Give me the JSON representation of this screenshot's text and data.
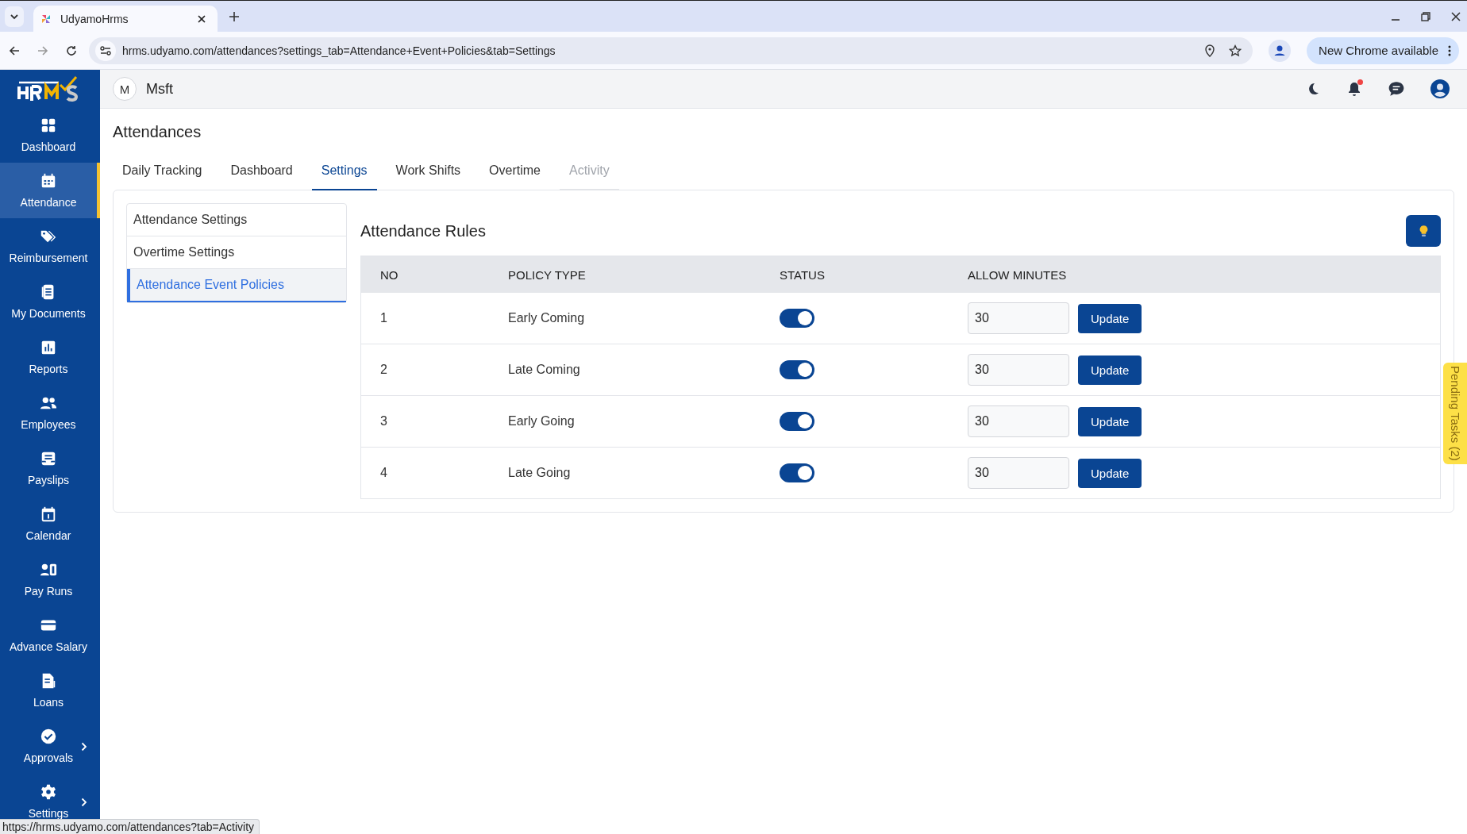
{
  "browser": {
    "tab_title": "UdyamoHrms",
    "url": "hrms.udyamo.com/attendances?settings_tab=Attendance+Event+Policies&tab=Settings",
    "update_button": "New Chrome available"
  },
  "sidebar": {
    "items": [
      {
        "label": "Dashboard",
        "selected": false,
        "expandable": false
      },
      {
        "label": "Attendance",
        "selected": true,
        "expandable": false
      },
      {
        "label": "Reimbursement",
        "selected": false,
        "expandable": false
      },
      {
        "label": "My Documents",
        "selected": false,
        "expandable": false
      },
      {
        "label": "Reports",
        "selected": false,
        "expandable": false
      },
      {
        "label": "Employees",
        "selected": false,
        "expandable": false
      },
      {
        "label": "Payslips",
        "selected": false,
        "expandable": false
      },
      {
        "label": "Calendar",
        "selected": false,
        "expandable": false
      },
      {
        "label": "Pay Runs",
        "selected": false,
        "expandable": false
      },
      {
        "label": "Advance Salary",
        "selected": false,
        "expandable": false
      },
      {
        "label": "Loans",
        "selected": false,
        "expandable": false
      },
      {
        "label": "Approvals",
        "selected": false,
        "expandable": true
      },
      {
        "label": "Settings",
        "selected": false,
        "expandable": true
      }
    ]
  },
  "header": {
    "avatar_letter": "M",
    "company": "Msft",
    "notification_dot": true
  },
  "page": {
    "title": "Attendances",
    "tabs": [
      {
        "label": "Daily Tracking",
        "selected": false,
        "hovered": false
      },
      {
        "label": "Dashboard",
        "selected": false,
        "hovered": false
      },
      {
        "label": "Settings",
        "selected": true,
        "hovered": false
      },
      {
        "label": "Work Shifts",
        "selected": false,
        "hovered": false
      },
      {
        "label": "Overtime",
        "selected": false,
        "hovered": false
      },
      {
        "label": "Activity",
        "selected": false,
        "hovered": true
      }
    ],
    "settings_menu": [
      {
        "label": "Attendance Settings",
        "selected": false
      },
      {
        "label": "Overtime Settings",
        "selected": false
      },
      {
        "label": "Attendance Event Policies",
        "selected": true
      }
    ],
    "rules": {
      "title": "Attendance Rules",
      "columns": [
        "NO",
        "POLICY TYPE",
        "STATUS",
        "ALLOW MINUTES"
      ],
      "rows": [
        {
          "no": "1",
          "policy_type": "Early Coming",
          "on": true,
          "minutes": "30",
          "button": "Update"
        },
        {
          "no": "2",
          "policy_type": "Late Coming",
          "on": true,
          "minutes": "30",
          "button": "Update"
        },
        {
          "no": "3",
          "policy_type": "Early Going",
          "on": true,
          "minutes": "30",
          "button": "Update"
        },
        {
          "no": "4",
          "policy_type": "Late Going",
          "on": true,
          "minutes": "30",
          "button": "Update"
        }
      ]
    }
  },
  "pending_tasks": "Pending Tasks (2)",
  "status_link": "https://hrms.udyamo.com/attendances?tab=Activity"
}
